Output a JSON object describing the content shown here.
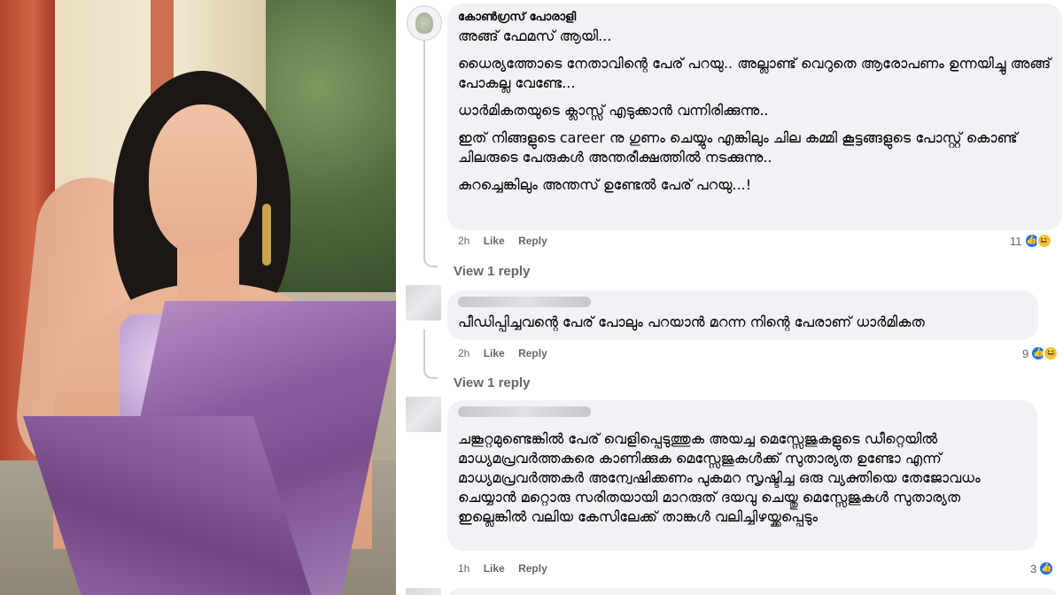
{
  "photo": {
    "subject": "woman-in-purple-saree"
  },
  "comments": [
    {
      "author": "കോൺഗ്രസ് പോരാളി",
      "paragraphs": [
        "അങ്ങ് ഫേമസ് ആയി...",
        "ധൈര്യത്തോടെ നേതാവിന്റെ പേര് പറയു.. അല്ലാണ്ട് വെറുതെ ആരോപണം ഉന്നയിച്ചു അങ്ങ് പോകല്ല വേണ്ടേ...",
        "ധാർമികതയുടെ ക്ലാസ്സ് എടുക്കാൻ വന്നിരിക്കുന്നു..",
        "ഇത് നിങ്ങളുടെ career നു ഗുണം ചെയ്യും എങ്കിലും ചില കമ്മി കൂട്ടങ്ങളുടെ പോസ്റ്റ് കൊണ്ട് ചിലരുടെ പേരുകൾ അന്തരീക്ഷത്തിൽ നടക്കുന്നു..",
        "കുറച്ചെങ്കിലും അന്തസ് ഉണ്ടേൽ പേര് പറയു...!"
      ],
      "time": "2h",
      "like": "Like",
      "reply": "Reply",
      "reaction_count": "11",
      "view_replies": "View 1 reply"
    },
    {
      "author": "",
      "paragraphs": [
        "പീഡിപ്പിച്ചവന്റെ പേര് പോലും പറയാൻ മറന്ന നിന്റെ പേരാണ് ധാർമികത"
      ],
      "time": "2h",
      "like": "Like",
      "reply": "Reply",
      "reaction_count": "9",
      "view_replies": "View 1 reply"
    },
    {
      "author": "",
      "paragraphs": [
        "ചങ്കൂറ്റമുണ്ടെങ്കിൽ പേര് വെളിപ്പെടുത്തുക അയച്ച മെസ്സേജുകളുടെ ഡീറ്റെയിൽ മാധ്യമപ്രവർത്തകരെ കാണിക്കുക മെസ്സേജുകൾക്ക് സുതാര്യത ഉണ്ടോ എന്ന് മാധ്യമപ്രവർത്തകർ അന്വേഷിക്കണം പുകമറ സൃഷ്ടിച്ച ഒരു വ്യക്തിയെ തേജോവധം ചെയ്യാൻ മറ്റൊരു സരിതയായി മാറരുത് ദയവു ചെയ്തു മെസ്സേജുകൾ സുതാര്യത ഇല്ലെങ്കിൽ വലിയ കേസിലേക്ക് താങ്കൾ വലിച്ചിഴയ്ക്കപ്പെടും"
      ],
      "time": "1h",
      "like": "Like",
      "reply": "Reply",
      "reaction_count": "3"
    }
  ],
  "colors": {
    "bubble": "#f0f2f5",
    "meta": "#65676b",
    "like_blue": "#1877f2",
    "haha_yellow": "#f7c33b"
  },
  "icons": {
    "reaction_like": "thumbs-up-icon",
    "reaction_haha": "laughing-face-icon"
  }
}
